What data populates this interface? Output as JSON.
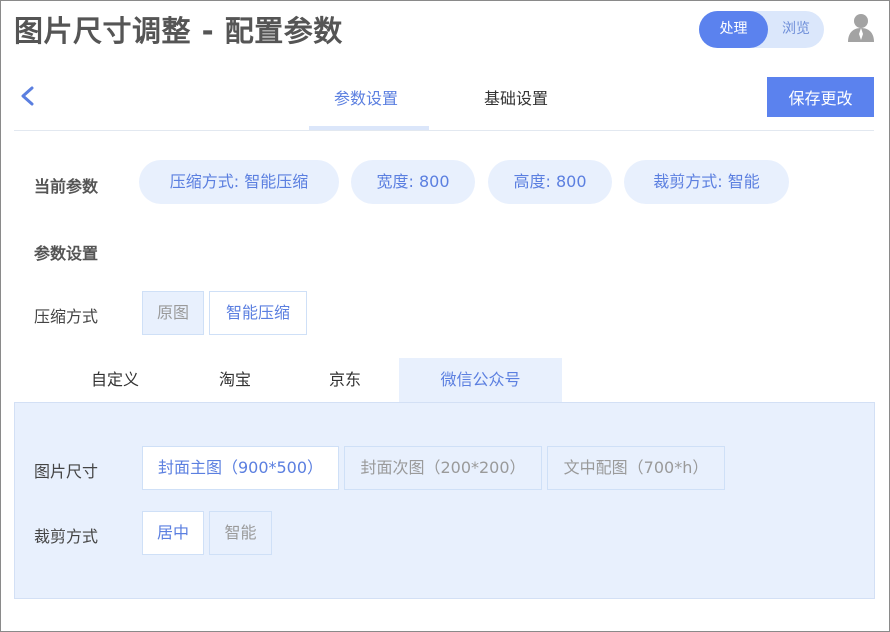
{
  "header": {
    "title": "图片尺寸调整 - 配置参数",
    "mode_toggle": {
      "process": "处理",
      "browse": "浏览",
      "active": "process"
    },
    "user_icon": "user-icon"
  },
  "nav": {
    "back_icon": "chevron-left-icon",
    "tabs": [
      {
        "label": "参数设置",
        "active": true
      },
      {
        "label": "基础设置",
        "active": false
      }
    ],
    "save_label": "保存更改"
  },
  "current_params": {
    "label": "当前参数",
    "chips": [
      "压缩方式: 智能压缩",
      "宽度: 800",
      "高度: 800",
      "裁剪方式: 智能"
    ]
  },
  "param_settings": {
    "label": "参数设置",
    "compression": {
      "label": "压缩方式",
      "options": [
        {
          "label": "原图",
          "selected": false
        },
        {
          "label": "智能压缩",
          "selected": true
        }
      ]
    }
  },
  "platform_tabs": [
    {
      "label": "自定义",
      "active": false
    },
    {
      "label": "淘宝",
      "active": false
    },
    {
      "label": "京东",
      "active": false
    },
    {
      "label": "微信公众号",
      "active": true
    }
  ],
  "platform_panel": {
    "size": {
      "label": "图片尺寸",
      "options": [
        {
          "label": "封面主图（900*500）",
          "selected": true
        },
        {
          "label": "封面次图（200*200）",
          "selected": false
        },
        {
          "label": "文中配图（700*h）",
          "selected": false
        }
      ]
    },
    "crop": {
      "label": "裁剪方式",
      "options": [
        {
          "label": "居中",
          "selected": true
        },
        {
          "label": "智能",
          "selected": false
        }
      ]
    }
  },
  "colors": {
    "accent": "#5b82ee",
    "accent_text": "#5b7fe0",
    "chip_bg": "#e8f0fd",
    "panel_bg": "#e8f0fd"
  }
}
